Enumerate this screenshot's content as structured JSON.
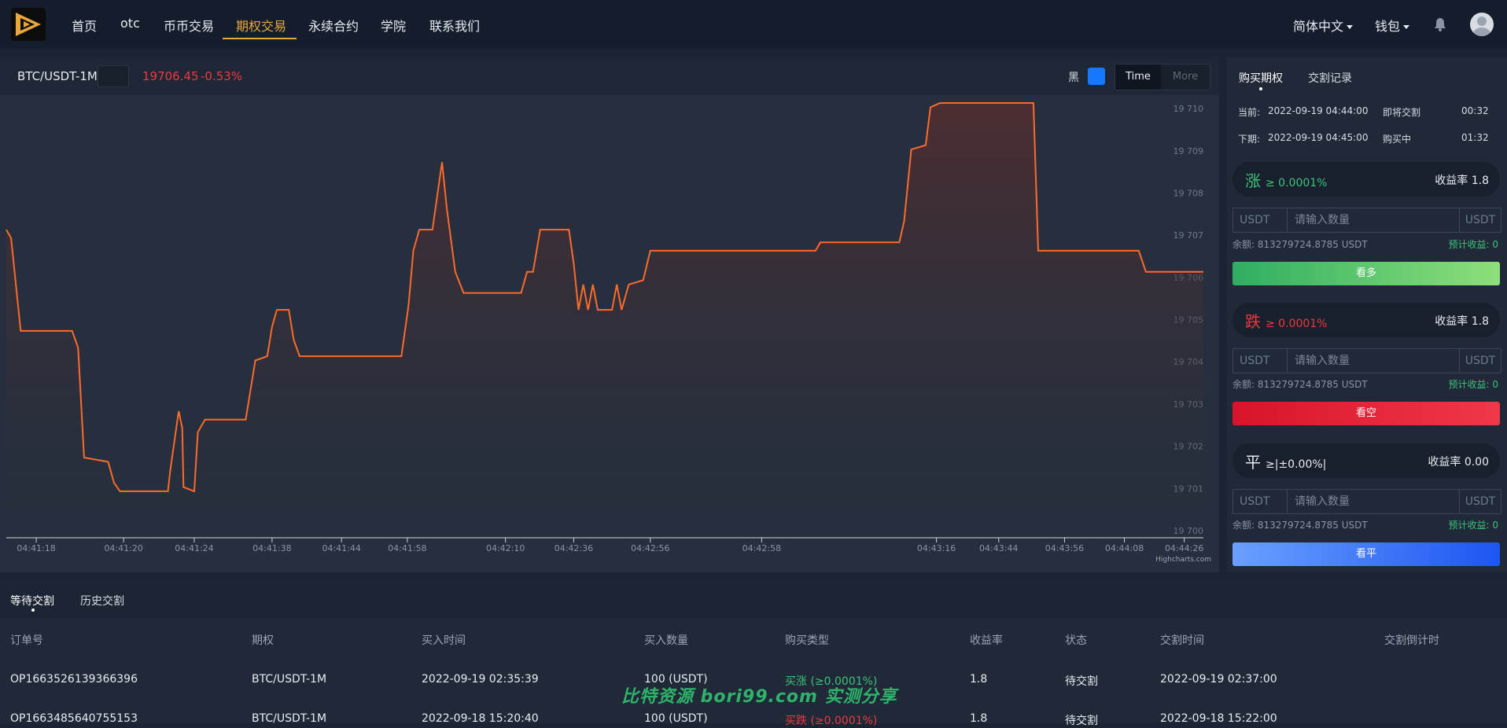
{
  "nav": {
    "items": [
      {
        "label": "首页"
      },
      {
        "label": "otc"
      },
      {
        "label": "币币交易"
      },
      {
        "label": "期权交易"
      },
      {
        "label": "永续合约"
      },
      {
        "label": "学院"
      },
      {
        "label": "联系我们"
      }
    ],
    "active": "期权交易",
    "language": "简体中文",
    "wallet": "钱包",
    "accent_color": "#e9a63b"
  },
  "chart_header": {
    "symbol": "BTC/USDT-1M",
    "symbol_button_icon": "",
    "price": "19706.45",
    "change": "-0.53%",
    "theme_label": "黑",
    "theme_toggle_icon": "",
    "time_label": "Time",
    "more_label": "More"
  },
  "chart_data": {
    "type": "area",
    "credit": "Highcharts.com",
    "line_color": "#ff6a2b",
    "x_labels": [
      "04:41:18",
      "04:41:20",
      "04:41:24",
      "04:41:38",
      "04:41:44",
      "04:41:58",
      "04:42:10",
      "04:42:36",
      "04:42:56",
      "04:42:58",
      "04:43:16",
      "04:43:44",
      "04:43:56",
      "04:44:08",
      "04:44:26"
    ],
    "y_ticks": [
      "19 700",
      "19 701",
      "19 702",
      "19 703",
      "19 704",
      "19 705",
      "19 706",
      "19 707",
      "19 708",
      "19 709",
      "19 710"
    ],
    "ylim": [
      19700,
      19710.3
    ],
    "series": [
      {
        "values": [
          [
            0,
            19707.3
          ],
          [
            0.004,
            19707.1
          ],
          [
            0.012,
            19704.9
          ],
          [
            0.055,
            19704.9
          ],
          [
            0.06,
            19704.5
          ],
          [
            0.065,
            19701.9
          ],
          [
            0.085,
            19701.8
          ],
          [
            0.09,
            19701.3
          ],
          [
            0.095,
            19701.1
          ],
          [
            0.135,
            19701.1
          ],
          [
            0.137,
            19701.6
          ],
          [
            0.144,
            19703.0
          ],
          [
            0.147,
            19702.6
          ],
          [
            0.148,
            19701.2
          ],
          [
            0.157,
            19701.1
          ],
          [
            0.16,
            19702.5
          ],
          [
            0.166,
            19702.8
          ],
          [
            0.2,
            19702.8
          ],
          [
            0.204,
            19703.5
          ],
          [
            0.208,
            19704.2
          ],
          [
            0.218,
            19704.3
          ],
          [
            0.222,
            19705.0
          ],
          [
            0.226,
            19705.4
          ],
          [
            0.236,
            19705.4
          ],
          [
            0.24,
            19704.7
          ],
          [
            0.245,
            19704.3
          ],
          [
            0.33,
            19704.3
          ],
          [
            0.336,
            19705.5
          ],
          [
            0.34,
            19706.8
          ],
          [
            0.345,
            19707.3
          ],
          [
            0.356,
            19707.3
          ],
          [
            0.36,
            19708.1
          ],
          [
            0.364,
            19708.9
          ],
          [
            0.368,
            19707.8
          ],
          [
            0.375,
            19706.3
          ],
          [
            0.382,
            19705.8
          ],
          [
            0.43,
            19705.8
          ],
          [
            0.435,
            19706.3
          ],
          [
            0.44,
            19706.3
          ],
          [
            0.446,
            19707.3
          ],
          [
            0.47,
            19707.3
          ],
          [
            0.474,
            19706.5
          ],
          [
            0.478,
            19705.4
          ],
          [
            0.482,
            19706.0
          ],
          [
            0.486,
            19705.4
          ],
          [
            0.49,
            19706.0
          ],
          [
            0.494,
            19705.4
          ],
          [
            0.506,
            19705.4
          ],
          [
            0.51,
            19706.0
          ],
          [
            0.514,
            19705.4
          ],
          [
            0.52,
            19706.0
          ],
          [
            0.532,
            19706.1
          ],
          [
            0.538,
            19706.8
          ],
          [
            0.676,
            19706.8
          ],
          [
            0.68,
            19707.0
          ],
          [
            0.746,
            19707.0
          ],
          [
            0.75,
            19707.5
          ],
          [
            0.756,
            19709.2
          ],
          [
            0.768,
            19709.3
          ],
          [
            0.772,
            19710.2
          ],
          [
            0.78,
            19710.3
          ],
          [
            0.858,
            19710.3
          ],
          [
            0.862,
            19706.8
          ],
          [
            0.946,
            19706.8
          ],
          [
            0.952,
            19706.3
          ],
          [
            1.0,
            19706.3
          ]
        ]
      }
    ]
  },
  "side": {
    "tabs": [
      "购买期权",
      "交割记录"
    ],
    "current_label": "当前:",
    "current_time": "2022-09-19 04:44:00",
    "current_status": "即将交割",
    "current_countdown": "00:32",
    "next_label": "下期:",
    "next_time": "2022-09-19 04:45:00",
    "next_status": "购买中",
    "next_countdown": "01:32",
    "rise": {
      "icon": "",
      "title": "涨",
      "threshold": "≥ 0.0001%",
      "info_icon": "",
      "rate": "收益率 1.8",
      "unit_left": "USDT ",
      "placeholder": "请输入数量",
      "unit_right": "USDT",
      "balance": "余额: 813279724.8785 USDT",
      "profit": "预计收益: 0",
      "button": "看多",
      "color": "#3ec17b"
    },
    "fall": {
      "icon": "",
      "title": "跌",
      "threshold": "≥ 0.0001%",
      "info_icon": "",
      "rate": "收益率 1.8",
      "unit_left": "USDT ",
      "placeholder": "请输入数量",
      "unit_right": "USDT",
      "balance": "余额: 813279724.8785 USDT",
      "profit": "预计收益: 0",
      "button": "看空",
      "color": "#f0383f"
    },
    "flat": {
      "title": "平",
      "threshold": "≥|±0.00%|",
      "rate": "收益率 0.00",
      "unit_left": "USDT ",
      "placeholder": "请输入数量",
      "unit_right": "USDT",
      "balance": "余额: 813279724.8785 USDT",
      "profit": "预计收益: 0",
      "button": "看平"
    }
  },
  "orders": {
    "tabs": [
      "等待交割",
      "历史交割"
    ],
    "headers": [
      "订单号",
      "期权",
      "买入时间",
      "买入数量",
      "购买类型",
      "收益率",
      "状态",
      "交割时间",
      "交割倒计时"
    ],
    "rows": [
      [
        "OP1663526139366396",
        "BTC/USDT-1M",
        "2022-09-19 02:35:39",
        "100 (USDT)",
        "买涨 (≥0.0001%)",
        "1.8",
        "待交割",
        "2022-09-19 02:37:00",
        ""
      ],
      [
        "OP1663485640755153",
        "BTC/USDT-1M",
        "2022-09-18 15:20:40",
        "100 (USDT)",
        "买跌 (≥0.0001%)",
        "1.8",
        "待交割",
        "2022-09-18 15:22:00",
        ""
      ]
    ]
  },
  "watermark": "比特资源 bori99.com 实测分享"
}
